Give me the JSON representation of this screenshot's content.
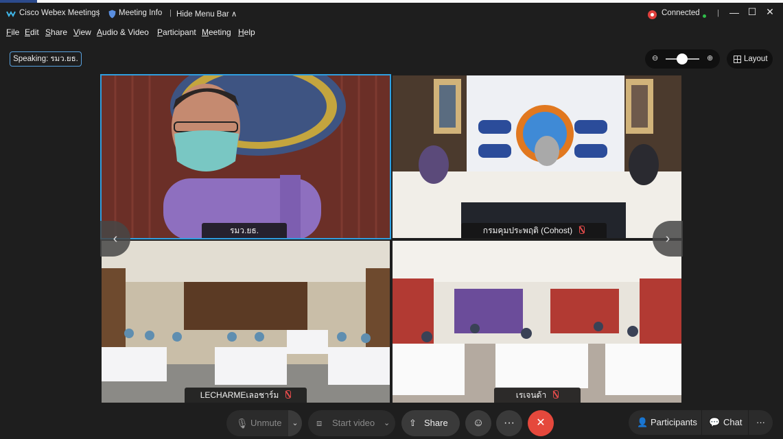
{
  "titlebar": {
    "app_name": "Cisco Webex Meetings",
    "meeting_info": "Meeting Info",
    "hide_menu": "Hide Menu Bar ∧",
    "sep": "|",
    "status": "Connected"
  },
  "menu": {
    "items": [
      {
        "u": "F",
        "rest": "ile"
      },
      {
        "u": "E",
        "rest": "dit"
      },
      {
        "u": "S",
        "rest": "hare"
      },
      {
        "u": "V",
        "rest": "iew"
      },
      {
        "u": "A",
        "rest": "udio & Video"
      },
      {
        "u": "P",
        "rest": "articipant"
      },
      {
        "u": "M",
        "rest": "eeting"
      },
      {
        "u": "H",
        "rest": "elp"
      }
    ]
  },
  "speaking": "Speaking: รมว.ยธ.",
  "layout_label": "Layout",
  "tiles": [
    {
      "name": "รมว.ยธ."
    },
    {
      "name": "กรมคุมประพฤติ (Cohost)"
    },
    {
      "name": "LECHARMEเลอชาร์ม"
    },
    {
      "name": "เรเจนด้า"
    }
  ],
  "controls": {
    "unmute": "Unmute",
    "start_video": "Start video",
    "share": "Share",
    "participants": "Participants",
    "chat": "Chat"
  },
  "colors": {
    "active_speaker_border": "#2f9fe0",
    "end_call": "#e5483c",
    "connected_dot": "#2fbf4a"
  }
}
